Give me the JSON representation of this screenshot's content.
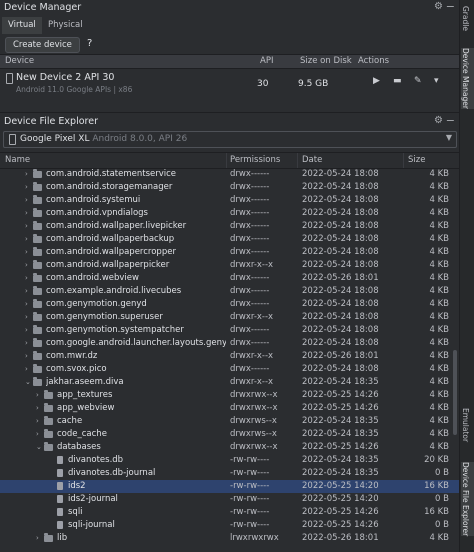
{
  "device_manager": {
    "title": "Device Manager",
    "tabs": [
      "Virtual",
      "Physical"
    ],
    "create_button": "Create device",
    "help": "?",
    "columns": {
      "device": "Device",
      "api": "API",
      "size": "Size on Disk",
      "actions": "Actions"
    },
    "device": {
      "name": "New Device 2 API 30",
      "subtitle": "Android 11.0 Google APIs | x86",
      "api": "30",
      "size": "9.5 GB"
    }
  },
  "file_explorer": {
    "title": "Device File Explorer",
    "device_name": "Google Pixel XL",
    "device_info": "Android 8.0.0, API 26",
    "columns": {
      "name": "Name",
      "permissions": "Permissions",
      "date": "Date",
      "size": "Size"
    },
    "rows": [
      {
        "name": "com.android.statementservice",
        "perm": "drwx------",
        "date": "2022-05-24 18:08",
        "size": "4 KB"
      },
      {
        "name": "com.android.storagemanager",
        "perm": "drwx------",
        "date": "2022-05-24 18:08",
        "size": "4 KB"
      },
      {
        "name": "com.android.systemui",
        "perm": "drwx------",
        "date": "2022-05-24 18:08",
        "size": "4 KB"
      },
      {
        "name": "com.android.vpndialogs",
        "perm": "drwx------",
        "date": "2022-05-24 18:08",
        "size": "4 KB"
      },
      {
        "name": "com.android.wallpaper.livepicker",
        "perm": "drwx------",
        "date": "2022-05-24 18:08",
        "size": "4 KB"
      },
      {
        "name": "com.android.wallpaperbackup",
        "perm": "drwx------",
        "date": "2022-05-24 18:08",
        "size": "4 KB"
      },
      {
        "name": "com.android.wallpapercropper",
        "perm": "drwx------",
        "date": "2022-05-24 18:08",
        "size": "4 KB"
      },
      {
        "name": "com.android.wallpaperpicker",
        "perm": "drwxr-x--x",
        "date": "2022-05-24 18:08",
        "size": "4 KB"
      },
      {
        "name": "com.android.webview",
        "perm": "drwx------",
        "date": "2022-05-26 18:01",
        "size": "4 KB"
      },
      {
        "name": "com.example.android.livecubes",
        "perm": "drwx------",
        "date": "2022-05-24 18:08",
        "size": "4 KB"
      },
      {
        "name": "com.genymotion.genyd",
        "perm": "drwx------",
        "date": "2022-05-24 18:08",
        "size": "4 KB"
      },
      {
        "name": "com.genymotion.superuser",
        "perm": "drwxr-x--x",
        "date": "2022-05-24 18:08",
        "size": "4 KB"
      },
      {
        "name": "com.genymotion.systempatcher",
        "perm": "drwx------",
        "date": "2022-05-24 18:08",
        "size": "4 KB"
      },
      {
        "name": "com.google.android.launcher.layouts.genymo",
        "perm": "drwx------",
        "date": "2022-05-24 18:08",
        "size": "4 KB"
      },
      {
        "name": "com.mwr.dz",
        "perm": "drwxr-x--x",
        "date": "2022-05-26 18:01",
        "size": "4 KB"
      },
      {
        "name": "com.svox.pico",
        "perm": "drwx------",
        "date": "2022-05-24 18:08",
        "size": "4 KB"
      },
      {
        "name": "jakhar.aseem.diva",
        "perm": "drwxr-x--x",
        "date": "2022-05-24 18:35",
        "size": "4 KB"
      },
      {
        "name": "app_textures",
        "perm": "drwxrwx--x",
        "date": "2022-05-25 14:26",
        "size": "4 KB"
      },
      {
        "name": "app_webview",
        "perm": "drwxrwx--x",
        "date": "2022-05-25 14:26",
        "size": "4 KB"
      },
      {
        "name": "cache",
        "perm": "drwxrws--x",
        "date": "2022-05-24 18:35",
        "size": "4 KB"
      },
      {
        "name": "code_cache",
        "perm": "drwxrws--x",
        "date": "2022-05-24 18:35",
        "size": "4 KB"
      },
      {
        "name": "databases",
        "perm": "drwxrwx--x",
        "date": "2022-05-25 14:26",
        "size": "4 KB"
      },
      {
        "name": "divanotes.db",
        "perm": "-rw-rw----",
        "date": "2022-05-24 18:35",
        "size": "20 KB"
      },
      {
        "name": "divanotes.db-journal",
        "perm": "-rw-rw----",
        "date": "2022-05-24 18:35",
        "size": "0 B"
      },
      {
        "name": "ids2",
        "perm": "-rw-rw----",
        "date": "2022-05-25 14:20",
        "size": "16 KB"
      },
      {
        "name": "ids2-journal",
        "perm": "-rw-rw----",
        "date": "2022-05-25 14:20",
        "size": "0 B"
      },
      {
        "name": "sqli",
        "perm": "-rw-rw----",
        "date": "2022-05-25 14:26",
        "size": "16 KB"
      },
      {
        "name": "sqli-journal",
        "perm": "-rw-rw----",
        "date": "2022-05-25 14:26",
        "size": "0 B"
      },
      {
        "name": "lib",
        "perm": "lrwxrwxrwx",
        "date": "2022-05-26 18:01",
        "size": "4 KB"
      }
    ]
  },
  "side_tabs": {
    "gradle": "Gradle",
    "device_manager": "Device Manager",
    "emulator": "Emulator",
    "file_explorer": "Device File Explorer"
  },
  "icons": {
    "gear": "gear-icon",
    "minimize": "minimize-icon",
    "play": "play-icon",
    "folder": "folder-icon",
    "edit": "edit-icon",
    "menu": "chevron-down-icon"
  }
}
